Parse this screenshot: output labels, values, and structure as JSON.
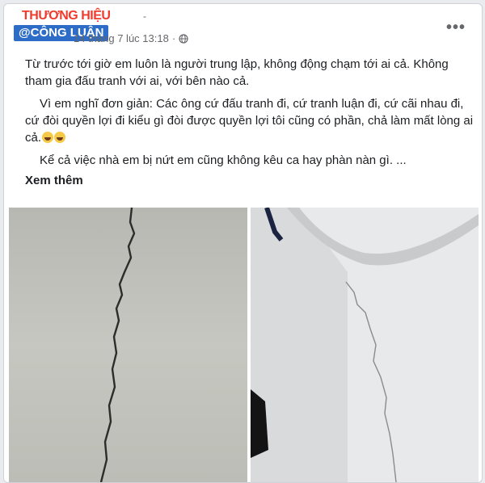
{
  "watermark": {
    "line1": "THƯƠNG HIỆU",
    "line2": "@CÔNG LUẬN"
  },
  "header": {
    "author_mark": "-",
    "timestamp": "14 tháng 7 lúc 13:18",
    "privacy_icon": "globe-icon",
    "more_label": "•••"
  },
  "post": {
    "paragraphs": [
      "Từ trước tới giờ em luôn là người trung lập, không động chạm tới ai cả. Không tham gia đấu tranh với ai, với bên nào cả.",
      "Vì em nghĩ đơn giản: Các ông cứ đấu tranh đi, cứ tranh luận đi, cứ cãi nhau đi, cứ đòi quyền lợi đi kiểu  gì đòi được quyền lợi tôi cũng có phần, chả làm mất lòng ai cả.",
      "Kể cả việc nhà em bị nứt em cũng không kêu ca hay phàn nàn gì. ..."
    ],
    "emojis": [
      "rolling-laughing-emoji",
      "rolling-laughing-emoji"
    ],
    "see_more": "Xem thêm"
  },
  "photos": [
    {
      "name": "wall-crack-photo-left"
    },
    {
      "name": "wall-crack-photo-right"
    }
  ]
}
